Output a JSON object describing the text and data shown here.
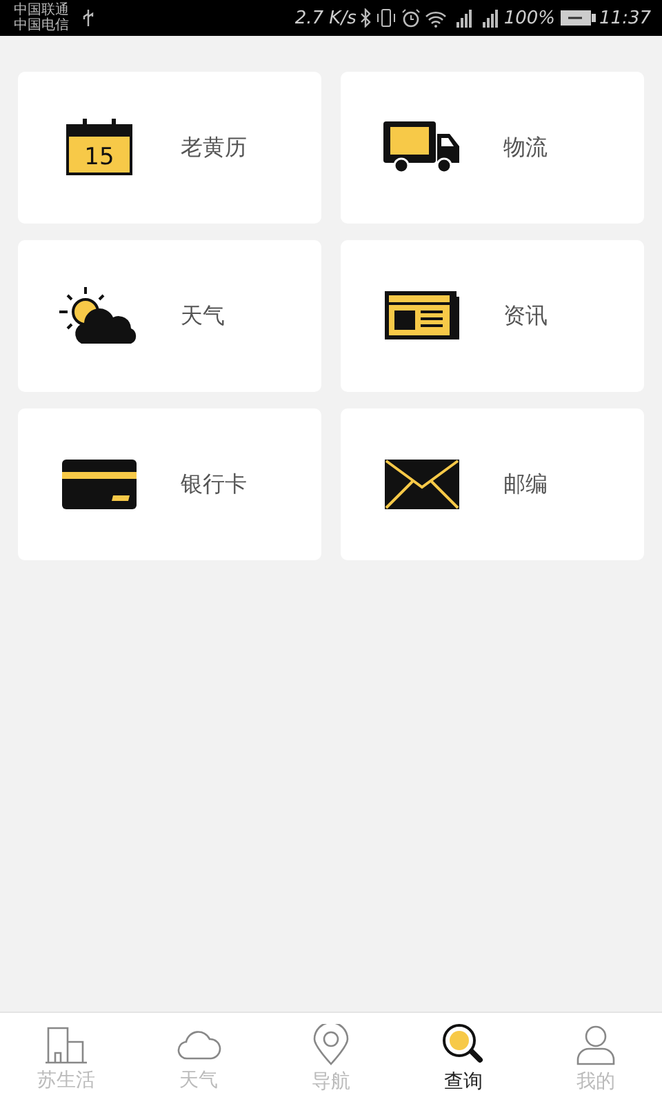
{
  "status_bar": {
    "carriers": [
      "中国联通",
      "中国电信"
    ],
    "speed": "2.7 K/s",
    "battery": "100%",
    "time": "11:37"
  },
  "tiles": [
    {
      "kind": "calendar",
      "label": "老黄历",
      "icon_text": "15"
    },
    {
      "kind": "truck",
      "label": "物流"
    },
    {
      "kind": "weather",
      "label": "天气"
    },
    {
      "kind": "news",
      "label": "资讯"
    },
    {
      "kind": "card",
      "label": "银行卡"
    },
    {
      "kind": "mail",
      "label": "邮编"
    }
  ],
  "tab_bar": [
    {
      "kind": "building",
      "label": "苏生活",
      "selected": false
    },
    {
      "kind": "cloud",
      "label": "天气",
      "selected": false
    },
    {
      "kind": "pin",
      "label": "导航",
      "selected": false
    },
    {
      "kind": "search",
      "label": "查询",
      "selected": true
    },
    {
      "kind": "person",
      "label": "我的",
      "selected": false
    }
  ]
}
